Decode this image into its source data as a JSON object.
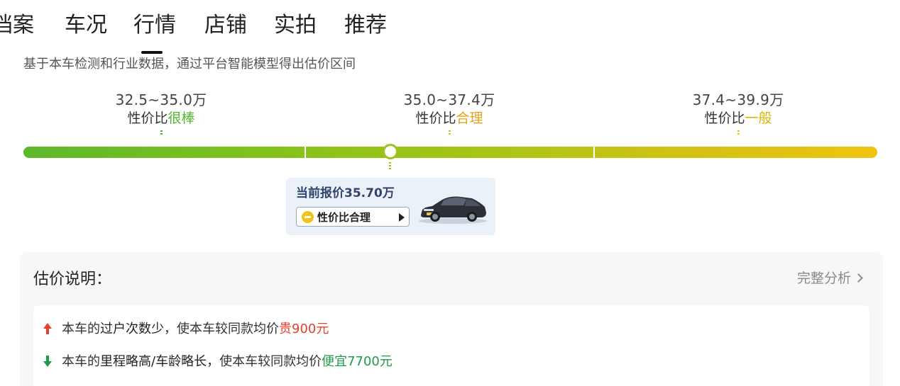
{
  "tabs": [
    {
      "label": "档案"
    },
    {
      "label": "车况"
    },
    {
      "label": "行情",
      "active": true
    },
    {
      "label": "店铺"
    },
    {
      "label": "实拍"
    },
    {
      "label": "推荐"
    }
  ],
  "description": "基于本车检测和行业数据，通过平台智能模型得出估价区间",
  "ranges": [
    {
      "price": "32.5~35.0万",
      "prefix": "性价比",
      "grade": "很棒",
      "color": "#52b42d"
    },
    {
      "price": "35.0~37.4万",
      "prefix": "性价比",
      "grade": "合理",
      "color": "#e3a21a"
    },
    {
      "price": "37.4~39.9万",
      "prefix": "性价比",
      "grade": "一般",
      "color": "#d8b800"
    }
  ],
  "marker_value": 35.7,
  "scale": {
    "min": 32.5,
    "max": 39.9
  },
  "current": {
    "title": "当前报价35.70万",
    "badge": "性价比合理",
    "badge_icon": "neutral-face-icon",
    "car_icon": "sedan-car-icon"
  },
  "explanation": {
    "title": "估价说明：",
    "link": "完整分析",
    "items": [
      {
        "direction": "up",
        "pre": "本车的",
        "factor": "过户次数少",
        "mid": "，使本车较同款均价",
        "effect": "贵900元"
      },
      {
        "direction": "down",
        "pre": "本车的",
        "factor": "里程略高/车龄略长",
        "mid": "，使本车较同款均价",
        "effect": "便宜7700元"
      }
    ]
  },
  "colors": {
    "red": "#e8402e",
    "green": "#1f9a4a",
    "bar_start": "#5db82b",
    "bar_end": "#efc40f"
  }
}
